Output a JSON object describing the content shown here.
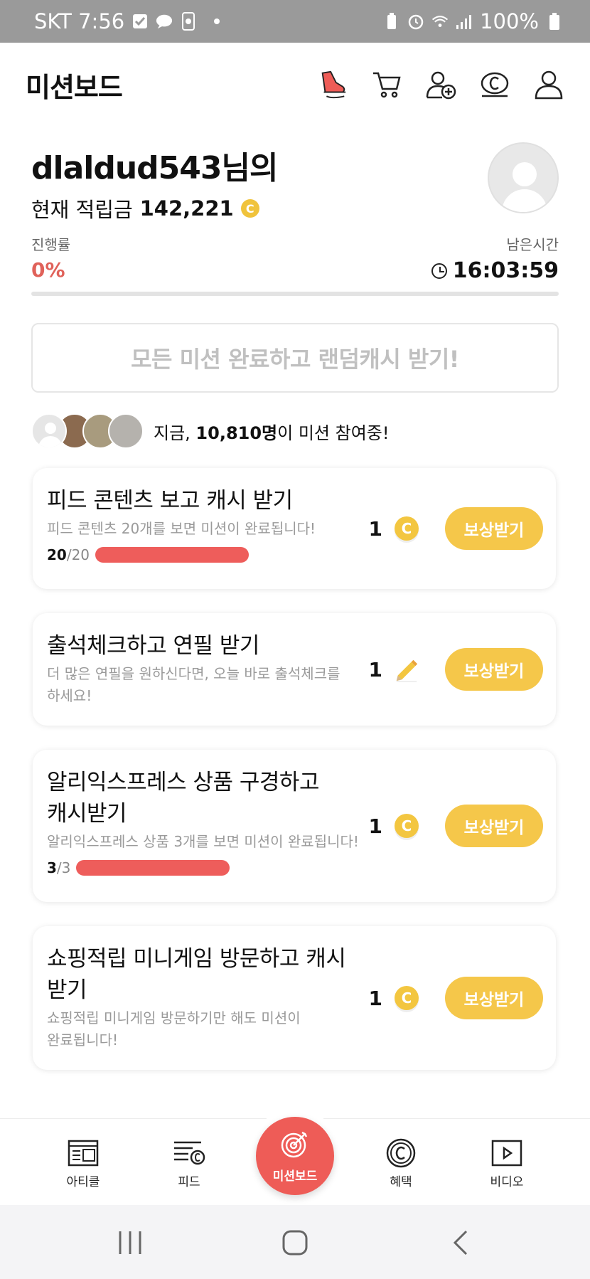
{
  "status_bar": {
    "carrier_time": "SKT 7:56",
    "battery": "100%"
  },
  "header": {
    "title": "미션보드",
    "icons": [
      "sneaker-icon",
      "cart-icon",
      "add-friend-icon",
      "cash-coin-icon",
      "profile-icon"
    ]
  },
  "profile": {
    "username": "dlaldud543님의",
    "points_label": "현재 적립금",
    "points_value": "142,221",
    "coin_symbol": "C"
  },
  "progress": {
    "label": "진행률",
    "value": "0%",
    "fraction": 0.0
  },
  "remaining": {
    "label": "남은시간",
    "time": "16:03:59"
  },
  "complete_all_label": "모든 미션 완료하고 랜덤캐시 받기!",
  "participants": {
    "prefix": "지금, ",
    "count": "10,810명",
    "suffix": "이 미션 참여중!"
  },
  "missions": [
    {
      "title": "피드 콘텐츠 보고 캐시 받기",
      "desc": "피드 콘텐츠 20개를 보면 미션이 완료됩니다!",
      "progress_done": "20",
      "progress_total": "/20",
      "progress_fraction": 1.0,
      "reward_amount": "1",
      "reward_icon": "coin-icon",
      "button": "보상받기"
    },
    {
      "title": "출석체크하고 연필 받기",
      "desc_line1": "더 많은 연필을 원하신다면, 오늘 바로 출석체크를",
      "desc_line2": "하세요!",
      "reward_amount": "1",
      "reward_icon": "pencil-icon",
      "button": "보상받기"
    },
    {
      "title_line1": "알리익스프레스 상품 구경하고",
      "title_line2": "캐시받기",
      "desc": "알리익스프레스 상품 3개를 보면 미션이 완료됩니다!",
      "progress_done": "3",
      "progress_total": "/3",
      "progress_fraction": 1.0,
      "reward_amount": "1",
      "reward_icon": "coin-icon",
      "button": "보상받기"
    },
    {
      "title_line1": "쇼핑적립 미니게임 방문하고 캐시",
      "title_line2": "받기",
      "desc_line1": "쇼핑적립 미니게임 방문하기만 해도 미션이",
      "desc_line2": "완료됩니다!",
      "reward_amount": "1",
      "reward_icon": "coin-icon",
      "button": "보상받기"
    }
  ],
  "bottom_nav": {
    "article": "아티클",
    "feed": "피드",
    "missionboard": "미션보드",
    "benefit": "혜택",
    "video": "비디오"
  },
  "colors": {
    "accent_red": "#ee5c57",
    "reward_yellow": "#f5c74a",
    "coin_yellow": "#f0c33c"
  }
}
